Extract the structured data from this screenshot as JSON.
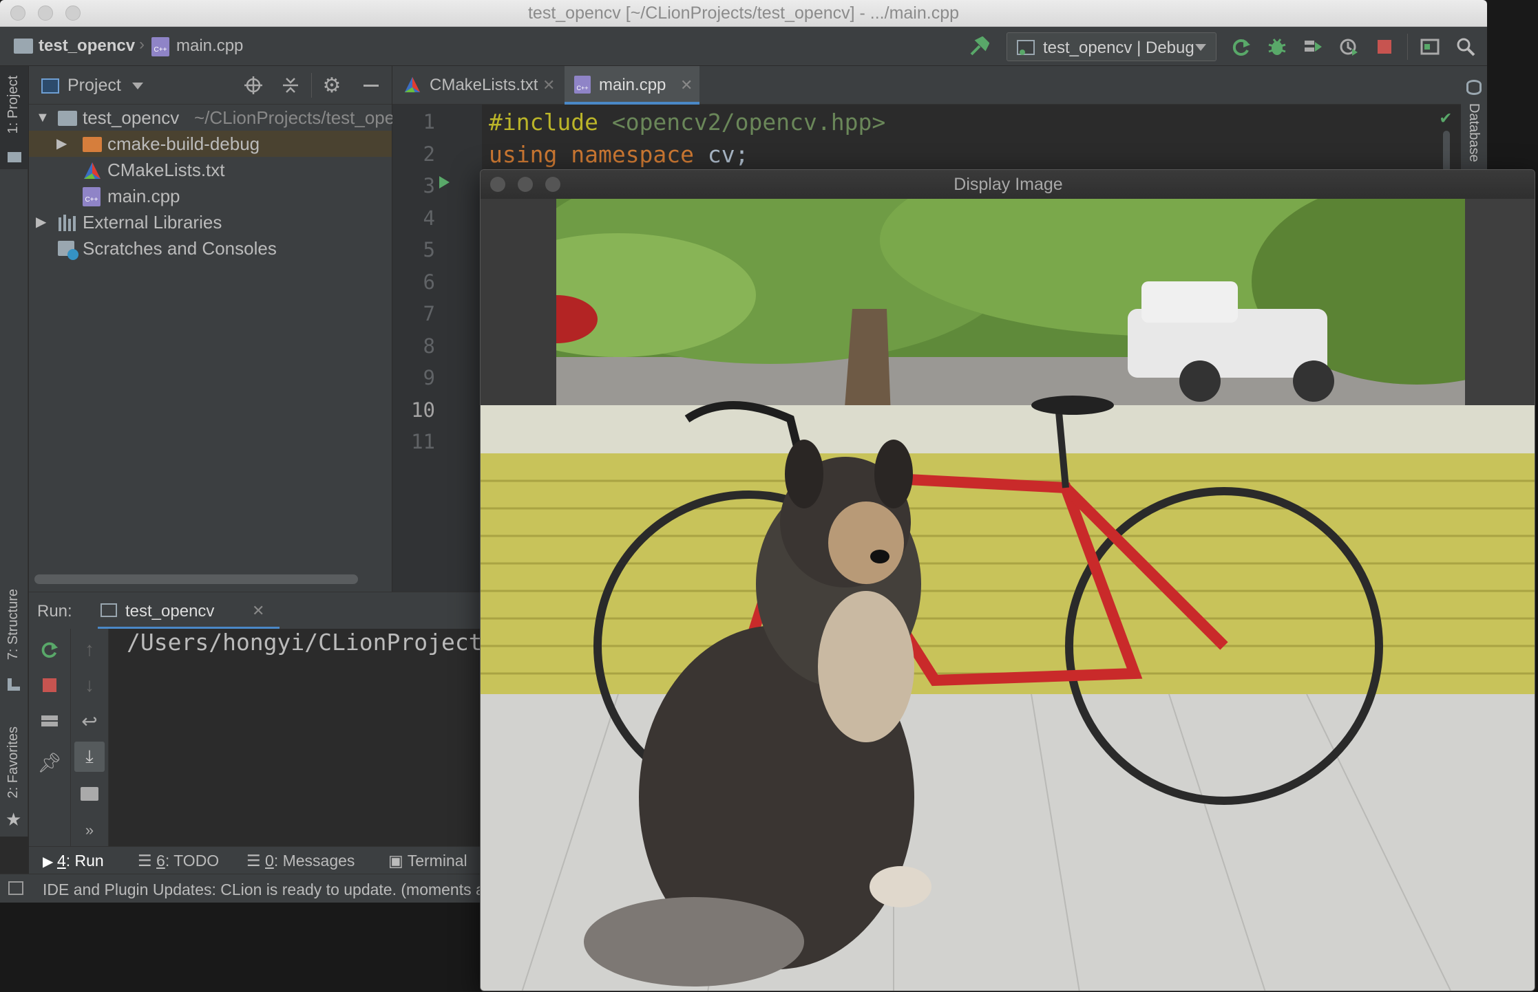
{
  "window": {
    "title": "test_opencv [~/CLionProjects/test_opencv] - .../main.cpp"
  },
  "navbar": {
    "project": "test_opencv",
    "file": "main.cpp",
    "run_config": "test_opencv | Debug"
  },
  "sidebar": {
    "left_top_tab": "1: Project",
    "structure_tab": "7: Structure",
    "favorites_tab": "2: Favorites",
    "right_tab": "Database"
  },
  "project_panel": {
    "title": "Project",
    "tree": [
      {
        "label": "test_opencv",
        "path": "~/CLionProjects/test_ope"
      },
      {
        "label": "cmake-build-debug"
      },
      {
        "label": "CMakeLists.txt"
      },
      {
        "label": "main.cpp"
      },
      {
        "label": "External Libraries"
      },
      {
        "label": "Scratches and Consoles"
      }
    ]
  },
  "editor": {
    "tabs": [
      {
        "label": "CMakeLists.txt"
      },
      {
        "label": "main.cpp"
      }
    ],
    "line_numbers": [
      "1",
      "2",
      "3",
      "4",
      "5",
      "6",
      "7",
      "8",
      "9",
      "10",
      "11"
    ],
    "code": {
      "line1_kw": "#include",
      "line1_str": "<opencv2/opencv.hpp>",
      "line2_kw1": "using",
      "line2_kw2": "namespace",
      "line2_rest": "cv;"
    }
  },
  "run_panel": {
    "label": "Run:",
    "tab": "test_opencv",
    "output": "/Users/hongyi/CLionProject"
  },
  "bottom_tabs": [
    {
      "num": "4",
      "label": ": Run"
    },
    {
      "num": "6",
      "label": ": TODO"
    },
    {
      "num": "0",
      "label": ": Messages"
    },
    {
      "label": "Terminal"
    }
  ],
  "status_bar": {
    "message": "IDE and Plugin Updates: CLion is ready to update. (moments ago)"
  },
  "display_window": {
    "title": "Display Image"
  }
}
